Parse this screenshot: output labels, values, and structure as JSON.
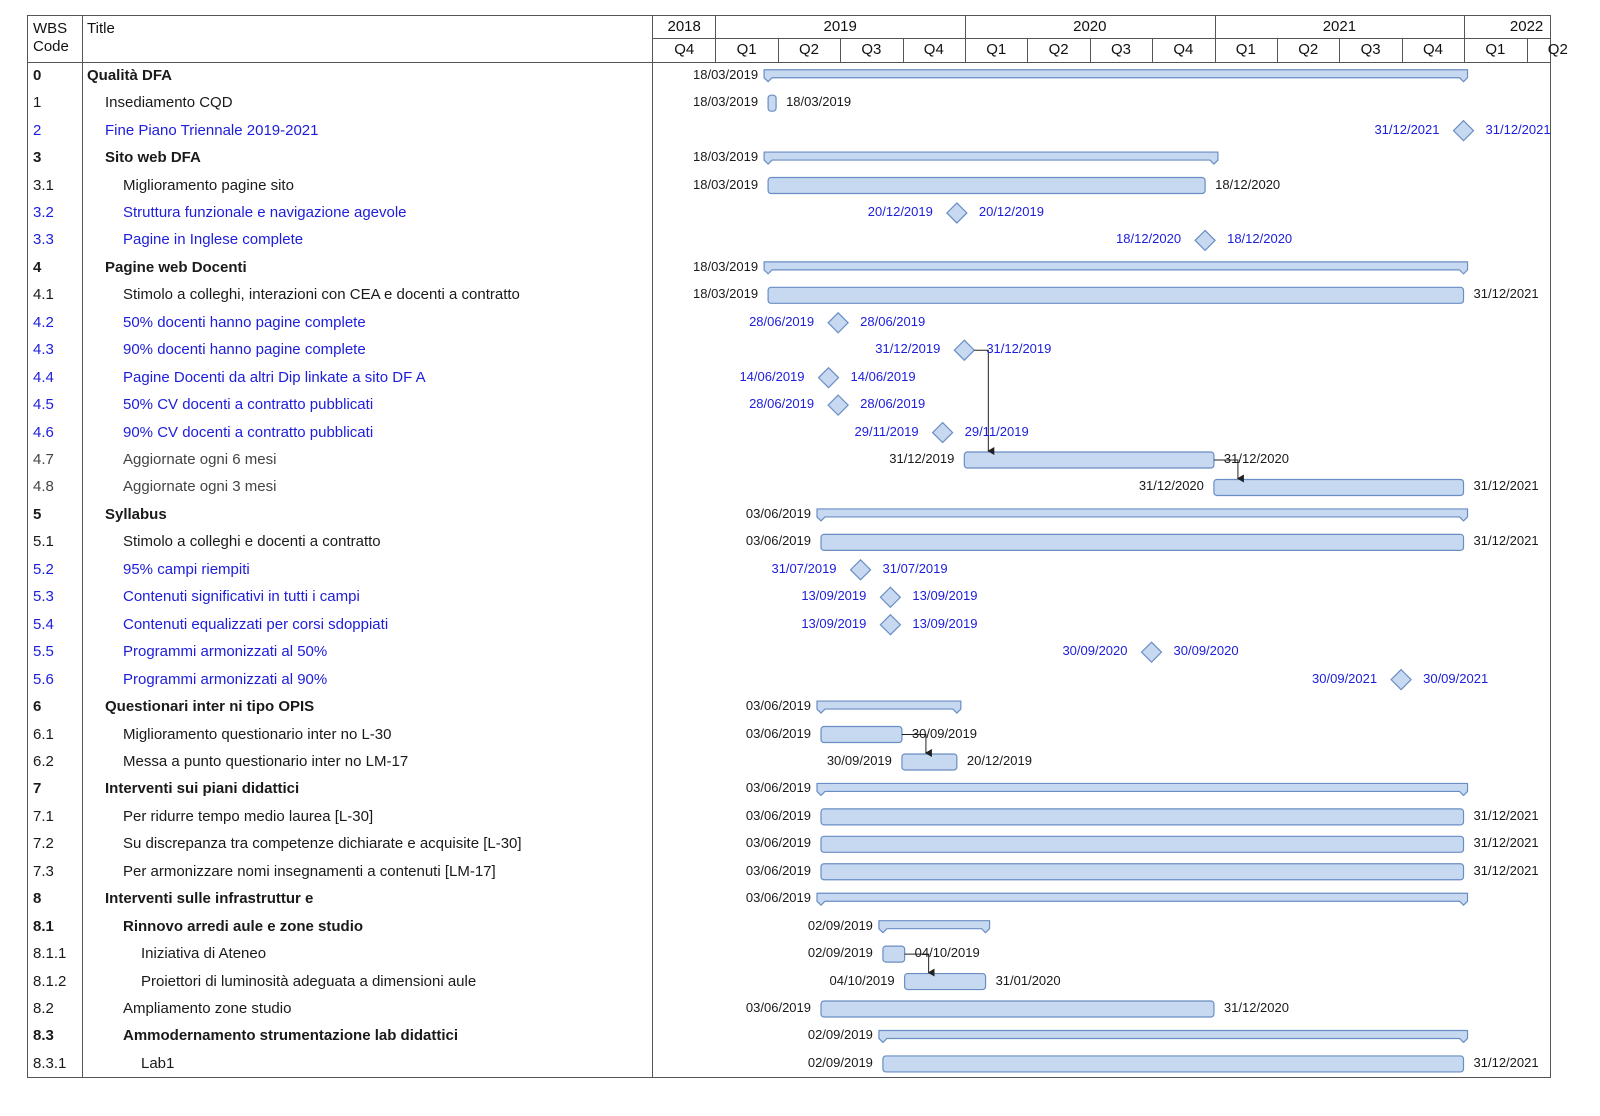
{
  "header": {
    "wbs_label": "WBS\nCode",
    "title_label": "Title"
  },
  "colors": {
    "bar_fill": "#c6d9f1",
    "bar_stroke": "#6a8dc4",
    "milestone_text": "#1d1ddb",
    "text": "#1a1a1a",
    "grid": "#555555"
  },
  "chart_data": {
    "type": "gantt",
    "timeline": {
      "years": [
        {
          "label": "2018",
          "quarters": 1
        },
        {
          "label": "2019",
          "quarters": 4
        },
        {
          "label": "2020",
          "quarters": 4
        },
        {
          "label": "2021",
          "quarters": 4
        },
        {
          "label": "2022",
          "quarters": 2
        }
      ],
      "quarters": [
        "Q4",
        "Q1",
        "Q2",
        "Q3",
        "Q4",
        "Q1",
        "Q2",
        "Q3",
        "Q4",
        "Q1",
        "Q2",
        "Q3",
        "Q4",
        "Q1",
        "Q2"
      ],
      "range": [
        "2018-10-01",
        "2022-06-30"
      ]
    },
    "tasks": [
      {
        "code": "0",
        "title": "Qualità DFA",
        "kind": "summary",
        "bold": true,
        "indent": 0,
        "start": "18/03/2019",
        "end": "31/12/2021",
        "start_label": "18/03/2019"
      },
      {
        "code": "1",
        "title": "Insediamento CQD",
        "kind": "task",
        "indent": 1,
        "start": "18/03/2019",
        "end": "18/03/2019",
        "start_label": "18/03/2019",
        "end_label": "18/03/2019"
      },
      {
        "code": "2",
        "title": "Fine Piano Triennale 2019-2021",
        "kind": "milestone",
        "indent": 1,
        "start": "31/12/2021",
        "start_label": "31/12/2021",
        "end_label": "31/12/2021"
      },
      {
        "code": "3",
        "title": "Sito web DFA",
        "kind": "summary",
        "bold": true,
        "indent": 1,
        "start": "18/03/2019",
        "end": "31/12/2020",
        "start_label": "18/03/2019"
      },
      {
        "code": "3.1",
        "title": "Miglioramento pagine sito",
        "kind": "task",
        "indent": 2,
        "start": "18/03/2019",
        "end": "18/12/2020",
        "start_label": "18/03/2019",
        "end_label": "18/12/2020"
      },
      {
        "code": "3.2",
        "title": "Struttura funzionale e navigazione agevole",
        "kind": "milestone",
        "indent": 2,
        "start": "20/12/2019",
        "start_label": "20/12/2019",
        "end_label": "20/12/2019"
      },
      {
        "code": "3.3",
        "title": "Pagine in Inglese complete",
        "kind": "milestone",
        "indent": 2,
        "start": "18/12/2020",
        "start_label": "18/12/2020",
        "end_label": "18/12/2020"
      },
      {
        "code": "4",
        "title": "Pagine web Docenti",
        "kind": "summary",
        "bold": true,
        "indent": 1,
        "start": "18/03/2019",
        "end": "31/12/2021",
        "start_label": "18/03/2019"
      },
      {
        "code": "4.1",
        "title": "Stimolo a colleghi, interazioni con CEA e docenti a contratto",
        "kind": "task",
        "indent": 2,
        "start": "18/03/2019",
        "end": "31/12/2021",
        "start_label": "18/03/2019",
        "end_label": "31/12/2021"
      },
      {
        "code": "4.2",
        "title": "50% docenti hanno pagine complete",
        "kind": "milestone",
        "indent": 2,
        "start": "28/06/2019",
        "start_label": "28/06/2019",
        "end_label": "28/06/2019"
      },
      {
        "code": "4.3",
        "title": "90% docenti hanno pagine complete",
        "kind": "milestone",
        "indent": 2,
        "start": "31/12/2019",
        "start_label": "31/12/2019",
        "end_label": "31/12/2019"
      },
      {
        "code": "4.4",
        "title": "Pagine Docenti da altri Dip linkate a sito DF A",
        "kind": "milestone",
        "indent": 2,
        "start": "14/06/2019",
        "start_label": "14/06/2019",
        "end_label": "14/06/2019"
      },
      {
        "code": "4.5",
        "title": "50% CV docenti a contratto pubblicati",
        "kind": "milestone",
        "indent": 2,
        "start": "28/06/2019",
        "start_label": "28/06/2019",
        "end_label": "28/06/2019"
      },
      {
        "code": "4.6",
        "title": "90% CV docenti a contratto pubblicati",
        "kind": "milestone",
        "indent": 2,
        "start": "29/11/2019",
        "start_label": "29/11/2019",
        "end_label": "29/11/2019"
      },
      {
        "code": "4.7",
        "title": "Aggiornate ogni 6 mesi",
        "kind": "task",
        "indent": 2,
        "light": true,
        "start": "31/12/2019",
        "end": "31/12/2020",
        "start_label": "31/12/2019",
        "end_label": "31/12/2020"
      },
      {
        "code": "4.8",
        "title": "Aggiornate ogni 3 mesi",
        "kind": "task",
        "indent": 2,
        "light": true,
        "start": "31/12/2020",
        "end": "31/12/2021",
        "start_label": "31/12/2020",
        "end_label": "31/12/2021"
      },
      {
        "code": "5",
        "title": "Syllabus",
        "kind": "summary",
        "bold": true,
        "indent": 1,
        "start": "03/06/2019",
        "end": "31/12/2021",
        "start_label": "03/06/2019"
      },
      {
        "code": "5.1",
        "title": "Stimolo a colleghi e docenti a contratto",
        "kind": "task",
        "indent": 2,
        "start": "03/06/2019",
        "end": "31/12/2021",
        "start_label": "03/06/2019",
        "end_label": "31/12/2021"
      },
      {
        "code": "5.2",
        "title": "95% campi riempiti",
        "kind": "milestone",
        "indent": 2,
        "start": "31/07/2019",
        "start_label": "31/07/2019",
        "end_label": "31/07/2019"
      },
      {
        "code": "5.3",
        "title": "Contenuti significativi in tutti i campi",
        "kind": "milestone",
        "indent": 2,
        "start": "13/09/2019",
        "start_label": "13/09/2019",
        "end_label": "13/09/2019"
      },
      {
        "code": "5.4",
        "title": "Contenuti equalizzati per corsi sdoppiati",
        "kind": "milestone",
        "indent": 2,
        "start": "13/09/2019",
        "start_label": "13/09/2019",
        "end_label": "13/09/2019"
      },
      {
        "code": "5.5",
        "title": "Programmi armonizzati al 50%",
        "kind": "milestone",
        "indent": 2,
        "start": "30/09/2020",
        "start_label": "30/09/2020",
        "end_label": "30/09/2020"
      },
      {
        "code": "5.6",
        "title": "Programmi armonizzati al 90%",
        "kind": "milestone",
        "indent": 2,
        "start": "30/09/2021",
        "start_label": "30/09/2021",
        "end_label": "30/09/2021"
      },
      {
        "code": "6",
        "title": "Questionari inter ni tipo OPIS",
        "kind": "summary",
        "bold": true,
        "indent": 1,
        "start": "03/06/2019",
        "end": "20/12/2019",
        "start_label": "03/06/2019"
      },
      {
        "code": "6.1",
        "title": "Miglioramento questionario inter no L-30",
        "kind": "task",
        "indent": 2,
        "start": "03/06/2019",
        "end": "30/09/2019",
        "start_label": "03/06/2019",
        "end_label": "30/09/2019"
      },
      {
        "code": "6.2",
        "title": "Messa a punto questionario inter no LM-17",
        "kind": "task",
        "indent": 2,
        "start": "30/09/2019",
        "end": "20/12/2019",
        "start_label": "30/09/2019",
        "end_label": "20/12/2019"
      },
      {
        "code": "7",
        "title": "Interventi sui piani didattici",
        "kind": "summary",
        "bold": true,
        "indent": 1,
        "start": "03/06/2019",
        "end": "31/12/2021",
        "start_label": "03/06/2019"
      },
      {
        "code": "7.1",
        "title": "Per ridurre tempo medio laurea [L-30]",
        "kind": "task",
        "indent": 2,
        "start": "03/06/2019",
        "end": "31/12/2021",
        "start_label": "03/06/2019",
        "end_label": "31/12/2021"
      },
      {
        "code": "7.2",
        "title": "Su discrepanza tra competenze dichiarate e acquisite [L-30]",
        "kind": "task",
        "indent": 2,
        "start": "03/06/2019",
        "end": "31/12/2021",
        "start_label": "03/06/2019",
        "end_label": "31/12/2021"
      },
      {
        "code": "7.3",
        "title": "Per armonizzare nomi insegnamenti a contenuti [LM-17]",
        "kind": "task",
        "indent": 2,
        "start": "03/06/2019",
        "end": "31/12/2021",
        "start_label": "03/06/2019",
        "end_label": "31/12/2021"
      },
      {
        "code": "8",
        "title": "Interventi sulle infrastruttur e",
        "kind": "summary",
        "bold": true,
        "indent": 1,
        "start": "03/06/2019",
        "end": "31/12/2021",
        "start_label": "03/06/2019"
      },
      {
        "code": "8.1",
        "title": "Rinnovo arredi aule e zone studio",
        "kind": "summary",
        "bold": true,
        "indent": 2,
        "start": "02/09/2019",
        "end": "31/01/2020",
        "start_label": "02/09/2019"
      },
      {
        "code": "8.1.1",
        "title": "Iniziativa di Ateneo",
        "kind": "task",
        "indent": 3,
        "start": "02/09/2019",
        "end": "04/10/2019",
        "start_label": "02/09/2019",
        "end_label": "04/10/2019"
      },
      {
        "code": "8.1.2",
        "title": "Proiettori di luminosità adeguata a dimensioni aule",
        "kind": "task",
        "indent": 3,
        "start": "04/10/2019",
        "end": "31/01/2020",
        "start_label": "04/10/2019",
        "end_label": "31/01/2020"
      },
      {
        "code": "8.2",
        "title": "Ampliamento zone studio",
        "kind": "task",
        "indent": 2,
        "start": "03/06/2019",
        "end": "31/12/2020",
        "start_label": "03/06/2019",
        "end_label": "31/12/2020"
      },
      {
        "code": "8.3",
        "title": "Ammodernamento strumentazione lab didattici",
        "kind": "summary",
        "bold": true,
        "indent": 2,
        "start": "02/09/2019",
        "end": "31/12/2021",
        "start_label": "02/09/2019"
      },
      {
        "code": "8.3.1",
        "title": "Lab1",
        "kind": "task",
        "indent": 3,
        "start": "02/09/2019",
        "end": "31/12/2021",
        "start_label": "02/09/2019",
        "end_label": "31/12/2021"
      }
    ],
    "links": [
      {
        "from": "4.3",
        "to": "4.7"
      },
      {
        "from": "4.7",
        "to": "4.8"
      },
      {
        "from": "6.1",
        "to": "6.2"
      },
      {
        "from": "8.1.1",
        "to": "8.1.2"
      }
    ]
  }
}
